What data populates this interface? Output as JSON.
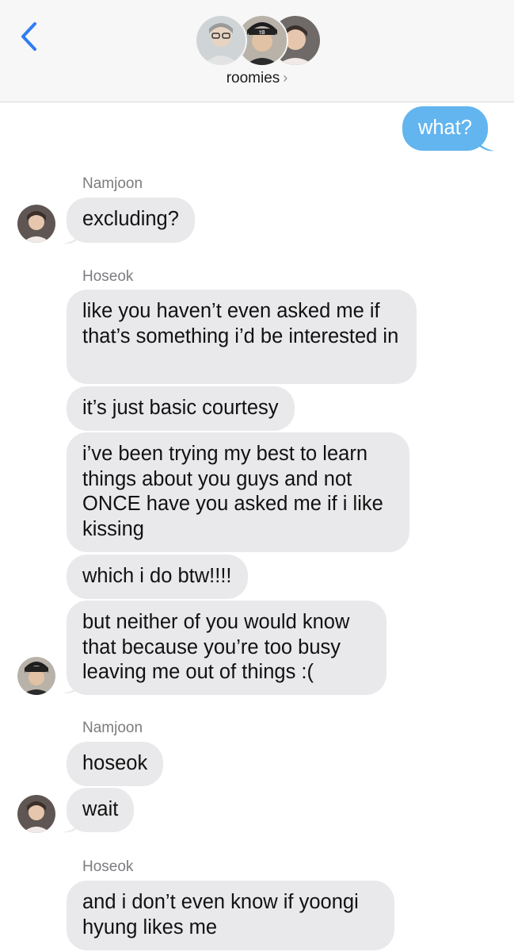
{
  "header": {
    "back_icon": "chevron-left-icon",
    "group_name": "roomies",
    "chevron": "›",
    "accent_color": "#2f7cf6"
  },
  "messages": {
    "sent_1": "what?",
    "sender_1": "Namjoon",
    "m1": "excluding?",
    "sender_2": "Hoseok",
    "m2": "like you haven’t even asked me if that’s something i’d be interested in",
    "m3": "it’s just basic courtesy",
    "m4": "i’ve been trying my best to learn things about you guys and not ONCE have you asked me if i like kissing",
    "m5": "which i do btw!!!!",
    "m6": "but neither of you would know that because you’re too busy leaving me out of things :(",
    "sender_3": "Namjoon",
    "m7": "hoseok",
    "m8": "wait",
    "sender_4": "Hoseok",
    "m9": "and i don’t even know if yoongi hyung likes me"
  },
  "colors": {
    "sent_bubble": "#62b5ef",
    "received_bubble": "#e9e9eb"
  }
}
